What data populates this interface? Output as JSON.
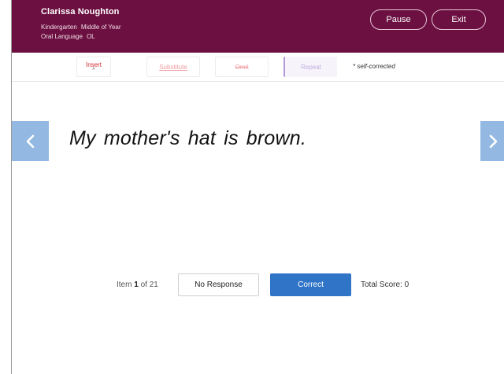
{
  "header": {
    "student_name": "Clarissa Noughton",
    "grade": "Kindergarten",
    "period": "Middle of Year",
    "subtest": "Oral Language",
    "subtest_code": "OL",
    "pause_label": "Pause",
    "exit_label": "Exit",
    "color": "#6b1040"
  },
  "toolbar": {
    "insert_label": "Insert",
    "insert_mark": "^",
    "substitute_label": "Substitute",
    "omit_label": "Omit",
    "repeat_label": "Repeat",
    "self_corrected_note": "* self-corrected"
  },
  "nav": {
    "prev_icon": "chevron-left-icon",
    "next_icon": "chevron-right-icon",
    "arrow_color": "#93b9e2"
  },
  "item": {
    "sentence": "My mother's hat is brown.",
    "label_prefix": "Item",
    "current": "1",
    "label_of": "of",
    "total": "21"
  },
  "actions": {
    "no_response_label": "No Response",
    "correct_label": "Correct",
    "correct_color": "#2f74c6"
  },
  "score": {
    "label": "Total Score:",
    "value": "0"
  }
}
